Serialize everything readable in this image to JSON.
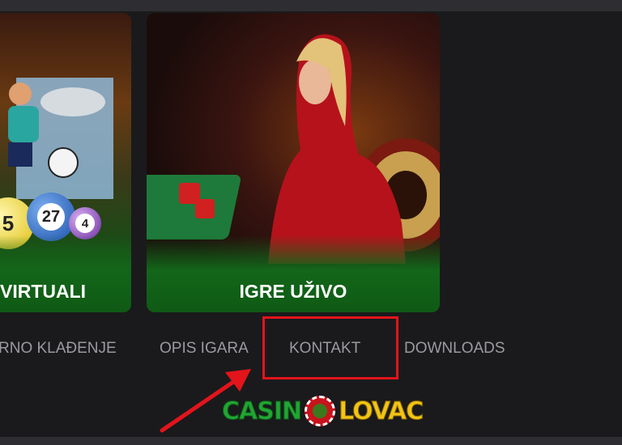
{
  "tiles": [
    {
      "label": "VIRTUALI",
      "art": "virtual-sports-lottery-art"
    },
    {
      "label": "IGRE UŽIVO",
      "art": "live-casino-dealer-roulette-art"
    }
  ],
  "nav": {
    "items": [
      "RNO KLAĐENJE",
      "OPIS IGARA",
      "KONTAKT",
      "DOWNLOADS"
    ]
  },
  "annotation": {
    "highlight_color": "#e3141b",
    "highlighted_item": "KONTAKT"
  },
  "logo": {
    "part1": "CASIN",
    "part2": "LOVAC",
    "chip_icon": "roulette-chip-icon"
  },
  "lottery_balls": [
    "5",
    "27",
    "4"
  ],
  "colors": {
    "background": "#1a1a1c",
    "nav_text": "#9a9aa0",
    "logo_green": "#21a534",
    "logo_yellow": "#f2c417"
  }
}
